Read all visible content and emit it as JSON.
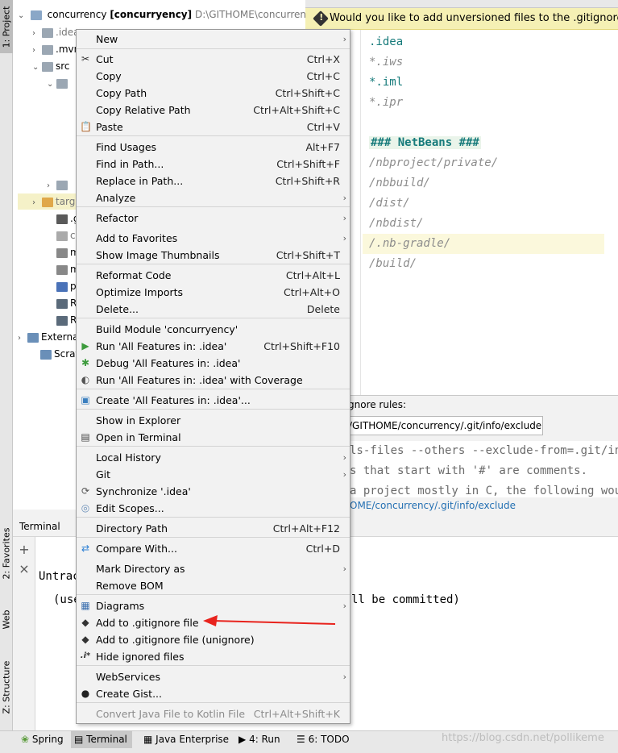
{
  "left_stripe": {
    "tabs": [
      "1: Project",
      "2: Favorites",
      "Web",
      "Z: Structure"
    ]
  },
  "project_tree": {
    "root": {
      "name": "concurrency",
      "module": "[concurryency]",
      "path": "D:\\GITHOME\\concurrency"
    },
    "rows": [
      {
        "label": ".idea",
        "style": "gray"
      },
      {
        "label": ".mvn",
        "style": "normal"
      },
      {
        "label": "src",
        "style": "normal"
      },
      {
        "label": "",
        "style": "normal"
      },
      {
        "label": "",
        "style": "normal"
      },
      {
        "label": "targ",
        "style": "gray"
      },
      {
        "label": ".gitign",
        "style": "normal"
      },
      {
        "label": "concurr",
        "style": "gray"
      },
      {
        "label": "mvnw",
        "style": "normal"
      },
      {
        "label": "mvnw.",
        "style": "normal"
      },
      {
        "label": "pom",
        "style": "normal"
      },
      {
        "label": "READ",
        "style": "normal"
      },
      {
        "label": "READ",
        "style": "normal"
      },
      {
        "label": "External",
        "style": "normal"
      },
      {
        "label": "Scratche",
        "style": "normal"
      }
    ]
  },
  "notification": {
    "text": "Would you like to add unversioned files to the .gitignore file?"
  },
  "editor": {
    "lines": [
      {
        "text": ".idea",
        "kind": "teal"
      },
      {
        "text": "*.iws",
        "kind": "italic"
      },
      {
        "text": "*.iml",
        "kind": "teal"
      },
      {
        "text": "*.ipr",
        "kind": "italic"
      },
      {
        "text": "",
        "kind": "blank"
      },
      {
        "text": "### NetBeans ###",
        "kind": "heading"
      },
      {
        "text": "/nbproject/private/",
        "kind": "italic"
      },
      {
        "text": "/nbbuild/",
        "kind": "italic"
      },
      {
        "text": "/dist/",
        "kind": "italic"
      },
      {
        "text": "/nbdist/",
        "kind": "italic"
      },
      {
        "text": "/.nb-gradle/",
        "kind": "italic"
      },
      {
        "text": "/build/",
        "kind": "italic"
      }
    ]
  },
  "ignore_rules": {
    "label": "gnore rules:",
    "path": "/GITHOME/concurrency/.git/info/exclude",
    "lines": [
      "ls-files --others --exclude-from=.git/info",
      "s that start with '#' are comments.",
      "a project mostly in C, the following would"
    ],
    "link": "OME/concurrency/.git/info/exclude"
  },
  "terminal": {
    "title": "Terminal",
    "line1": "Untrac",
    "line2": "(use",
    "line2_tail": "ll be committed)"
  },
  "status_bar": {
    "tabs": [
      "Spring",
      "Terminal",
      "Java Enterprise",
      "4: Run",
      "6: TODO"
    ],
    "watermark": "https://blog.csdn.net/pollikeme"
  },
  "context_menu": {
    "items": [
      {
        "label": "New",
        "shortcut": "",
        "submenu": true,
        "icon": ""
      },
      {
        "label": "Cut",
        "shortcut": "Ctrl+X",
        "submenu": false,
        "icon": "✂"
      },
      {
        "label": "Copy",
        "shortcut": "Ctrl+C",
        "submenu": false,
        "icon": ""
      },
      {
        "label": "Copy Path",
        "shortcut": "Ctrl+Shift+C",
        "submenu": false,
        "icon": ""
      },
      {
        "label": "Copy Relative Path",
        "shortcut": "Ctrl+Alt+Shift+C",
        "submenu": false,
        "icon": ""
      },
      {
        "label": "Paste",
        "shortcut": "Ctrl+V",
        "submenu": false,
        "icon": "📋"
      },
      {
        "label": "Find Usages",
        "shortcut": "Alt+F7",
        "submenu": false,
        "icon": ""
      },
      {
        "label": "Find in Path...",
        "shortcut": "Ctrl+Shift+F",
        "submenu": false,
        "icon": ""
      },
      {
        "label": "Replace in Path...",
        "shortcut": "Ctrl+Shift+R",
        "submenu": false,
        "icon": ""
      },
      {
        "label": "Analyze",
        "shortcut": "",
        "submenu": true,
        "icon": ""
      },
      {
        "label": "Refactor",
        "shortcut": "",
        "submenu": true,
        "icon": ""
      },
      {
        "label": "Add to Favorites",
        "shortcut": "",
        "submenu": true,
        "icon": ""
      },
      {
        "label": "Show Image Thumbnails",
        "shortcut": "Ctrl+Shift+T",
        "submenu": false,
        "icon": ""
      },
      {
        "label": "Reformat Code",
        "shortcut": "Ctrl+Alt+L",
        "submenu": false,
        "icon": ""
      },
      {
        "label": "Optimize Imports",
        "shortcut": "Ctrl+Alt+O",
        "submenu": false,
        "icon": ""
      },
      {
        "label": "Delete...",
        "shortcut": "Delete",
        "submenu": false,
        "icon": ""
      },
      {
        "label": "Build Module 'concurryency'",
        "shortcut": "",
        "submenu": false,
        "icon": ""
      },
      {
        "label": "Run 'All Features in: .idea'",
        "shortcut": "Ctrl+Shift+F10",
        "submenu": false,
        "icon": "▶"
      },
      {
        "label": "Debug 'All Features in: .idea'",
        "shortcut": "",
        "submenu": false,
        "icon": "✱"
      },
      {
        "label": "Run 'All Features in: .idea' with Coverage",
        "shortcut": "",
        "submenu": false,
        "icon": "◐"
      },
      {
        "label": "Create 'All Features in: .idea'...",
        "shortcut": "",
        "submenu": false,
        "icon": "▣"
      },
      {
        "label": "Show in Explorer",
        "shortcut": "",
        "submenu": false,
        "icon": ""
      },
      {
        "label": "Open in Terminal",
        "shortcut": "",
        "submenu": false,
        "icon": "▤"
      },
      {
        "label": "Local History",
        "shortcut": "",
        "submenu": true,
        "icon": ""
      },
      {
        "label": "Git",
        "shortcut": "",
        "submenu": true,
        "icon": ""
      },
      {
        "label": "Synchronize '.idea'",
        "shortcut": "",
        "submenu": false,
        "icon": "⟳"
      },
      {
        "label": "Edit Scopes...",
        "shortcut": "",
        "submenu": false,
        "icon": "◎"
      },
      {
        "label": "Directory Path",
        "shortcut": "Ctrl+Alt+F12",
        "submenu": false,
        "icon": ""
      },
      {
        "label": "Compare With...",
        "shortcut": "Ctrl+D",
        "submenu": false,
        "icon": "⇄"
      },
      {
        "label": "Mark Directory as",
        "shortcut": "",
        "submenu": true,
        "icon": ""
      },
      {
        "label": "Remove BOM",
        "shortcut": "",
        "submenu": false,
        "icon": ""
      },
      {
        "label": "Diagrams",
        "shortcut": "",
        "submenu": true,
        "icon": "▦"
      },
      {
        "label": "Add to .gitignore file",
        "shortcut": "",
        "submenu": false,
        "icon": "◆"
      },
      {
        "label": "Add to .gitignore file (unignore)",
        "shortcut": "",
        "submenu": false,
        "icon": "◆"
      },
      {
        "label": "Hide ignored files",
        "shortcut": "",
        "submenu": false,
        "icon": ".i*"
      },
      {
        "label": "WebServices",
        "shortcut": "",
        "submenu": true,
        "icon": ""
      },
      {
        "label": "Create Gist...",
        "shortcut": "",
        "submenu": false,
        "icon": "●"
      },
      {
        "label": "Convert Java File to Kotlin File",
        "shortcut": "Ctrl+Alt+Shift+K",
        "submenu": false,
        "icon": "",
        "disabled": true
      }
    ]
  },
  "colors": {
    "annotation_arrow": "#e8231d",
    "run_icon": "#3d9b3d",
    "debug_icon": "#3d9b3d",
    "link": "#2470b3"
  }
}
